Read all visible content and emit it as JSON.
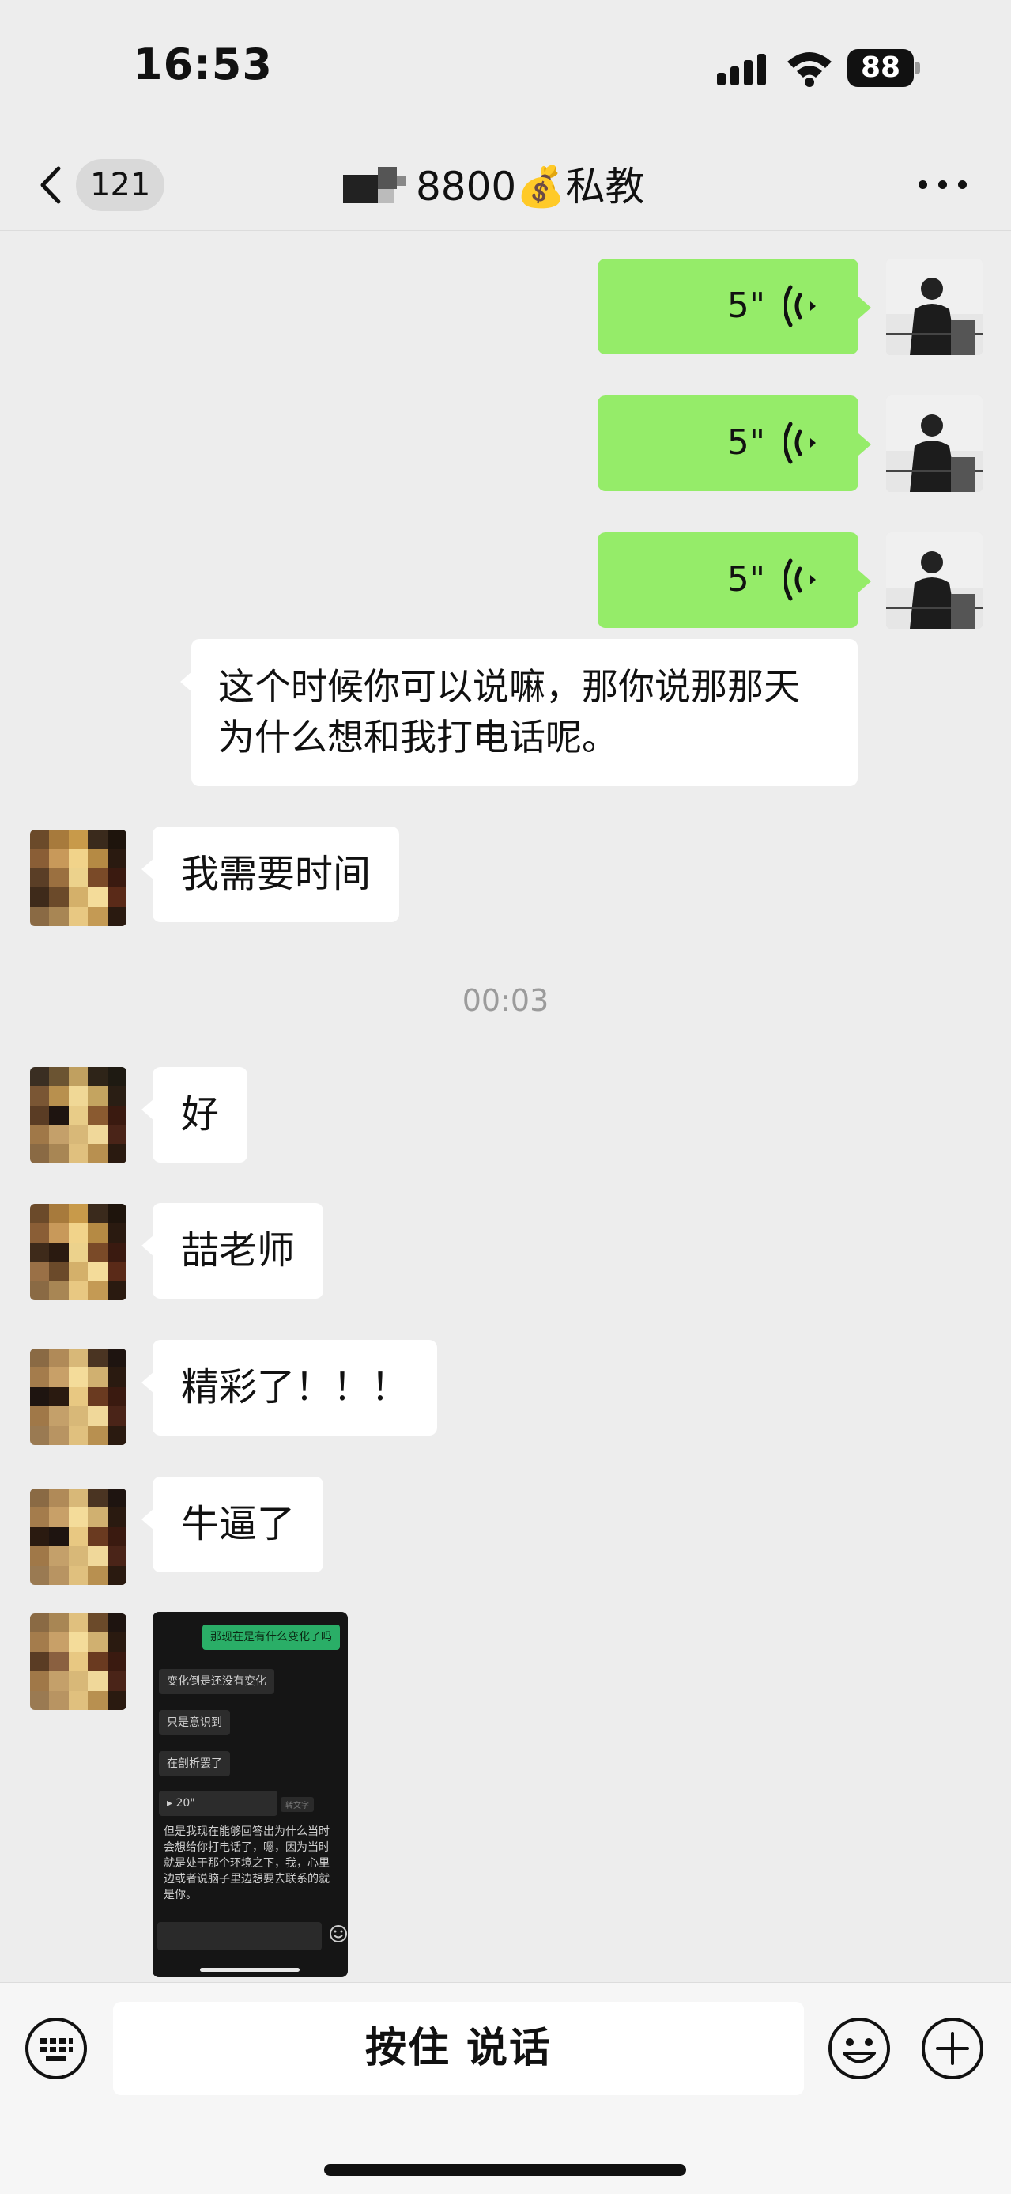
{
  "status_bar": {
    "time": "16:53",
    "battery": "88",
    "icons": [
      "cellular-signal-icon",
      "wifi-icon",
      "battery-icon"
    ]
  },
  "nav": {
    "back_count": "121",
    "title": "8800💰私教",
    "icons": [
      "back-chevron-icon",
      "more-dots-icon"
    ]
  },
  "messages": [
    {
      "from": "self",
      "type": "voice",
      "duration": "5\""
    },
    {
      "from": "self",
      "type": "voice",
      "duration": "5\""
    },
    {
      "from": "self",
      "type": "voice",
      "duration": "5\""
    },
    {
      "from": "other",
      "type": "text",
      "text": "这个时候你可以说嘛，那你说那那天为什么想和我打电话呢。"
    },
    {
      "from": "other",
      "type": "text",
      "text": "我需要时间"
    },
    {
      "type": "timestamp",
      "text": "00:03"
    },
    {
      "from": "other",
      "type": "text",
      "text": "好"
    },
    {
      "from": "other",
      "type": "text",
      "text": "喆老师"
    },
    {
      "from": "other",
      "type": "text",
      "text": "精彩了！！！"
    },
    {
      "from": "other",
      "type": "text",
      "text": "牛逼了"
    },
    {
      "from": "other",
      "type": "image",
      "content": {
        "top_green": "那现在是有什么变化了吗",
        "bubbles": [
          "变化倒是还没有变化",
          "只是意识到",
          "在剖析罢了"
        ],
        "voice_label": "20\"",
        "voice_hint": "转文字",
        "paragraph": "但是我现在能够回答出为什么当时会想给你打电话了，嗯，因为当时就是处于那个环境之下，我，心里边或者说脑子里边想要去联系的就是你。"
      }
    }
  ],
  "input_bar": {
    "hold_to_talk": "按住 说话",
    "icons": [
      "keyboard-icon",
      "emoji-icon",
      "plus-icon"
    ]
  },
  "colors": {
    "background": "#ededed",
    "self_bubble": "#95ec69",
    "other_bubble": "#ffffff",
    "timestamp": "#9b9b9b"
  }
}
